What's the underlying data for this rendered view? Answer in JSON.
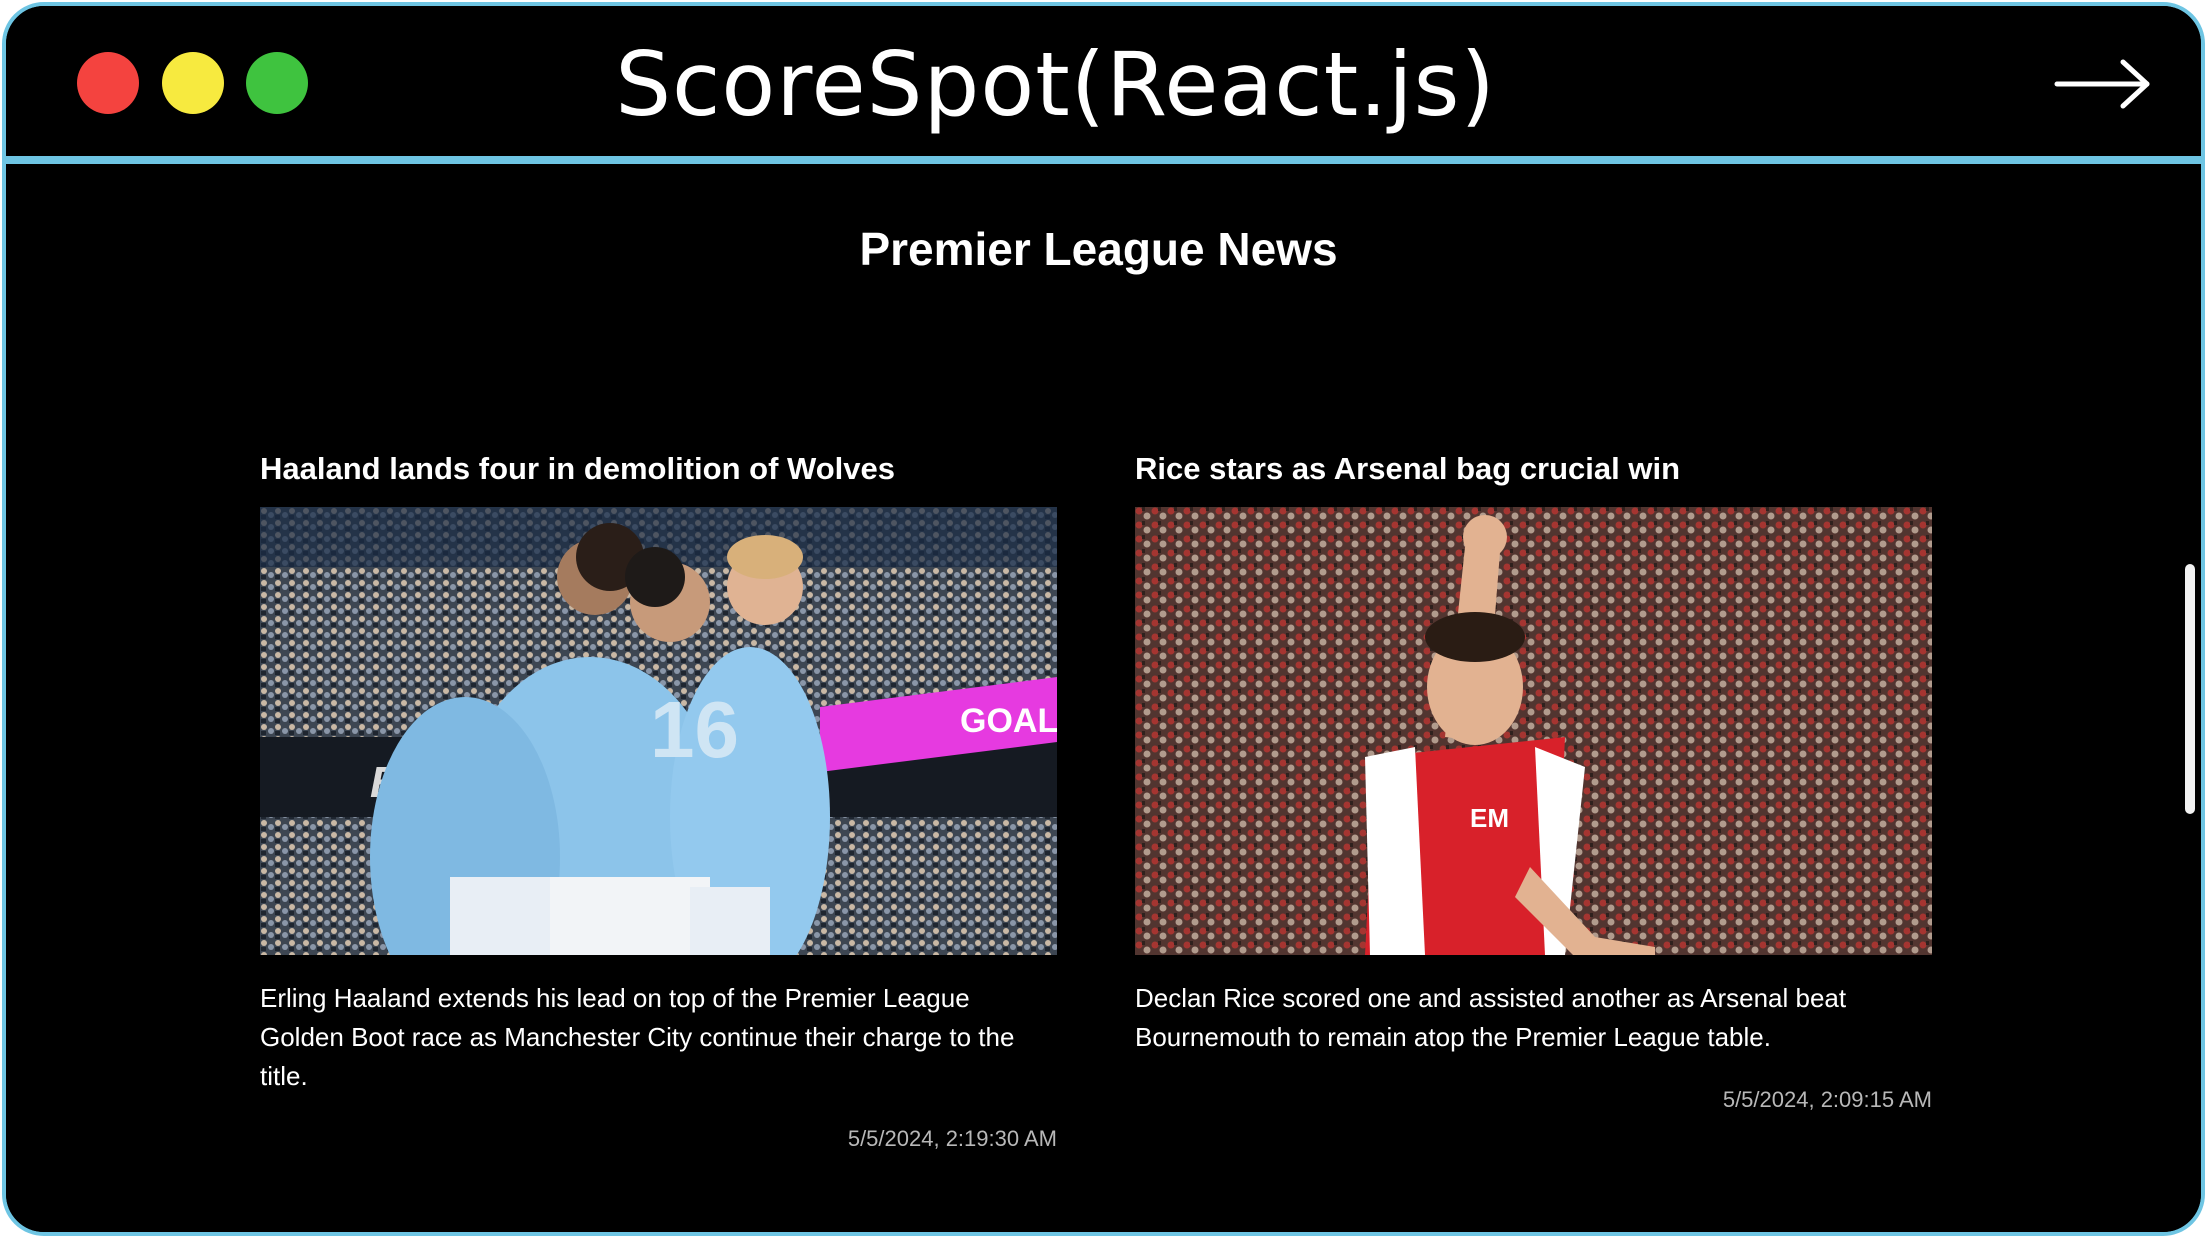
{
  "window": {
    "title": "ScoreSpot(React.js)",
    "controls": [
      "close-dot",
      "minimize-dot",
      "maximize-dot"
    ],
    "arrow_icon": "arrow-right-icon"
  },
  "page": {
    "title": "Premier League News"
  },
  "articles": [
    {
      "title": "Haaland lands four in demolition of Wolves",
      "image_icon": "photo-manchester-city-celebration",
      "description": "Erling Haaland extends his lead on top of the Premier League Golden Boot race as Manchester City continue their charge to the title.",
      "timestamp": "5/5/2024, 2:19:30 AM"
    },
    {
      "title": "Rice stars as Arsenal bag crucial win",
      "image_icon": "photo-declan-rice-celebration",
      "description": "Declan Rice scored one and assisted another as Arsenal beat Bournemouth to remain atop the Premier League table.",
      "timestamp": "5/5/2024, 2:09:15 AM"
    }
  ],
  "colors": {
    "frame": "#6ec5e3",
    "background": "#000000",
    "close": "#f4433f",
    "minimize": "#f7ea3f",
    "maximize": "#3fc33f",
    "city_blue": "#8cc4ea",
    "arsenal_red": "#d8212a"
  }
}
